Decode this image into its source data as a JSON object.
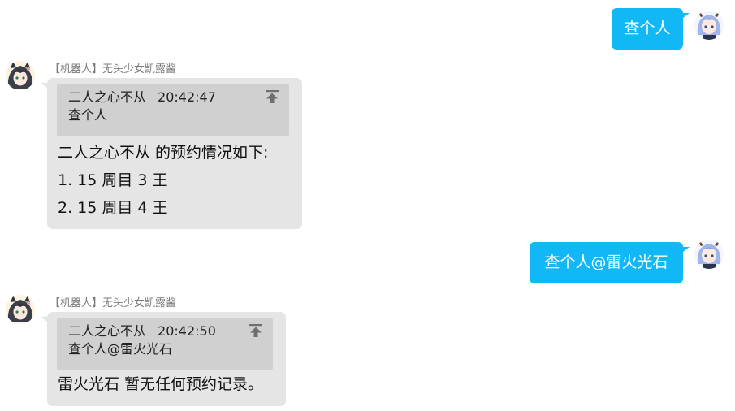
{
  "messages": [
    {
      "direction": "out",
      "text": "查个人"
    },
    {
      "direction": "in",
      "sender": "【机器人】无头少女凯露酱",
      "quote": {
        "name": "二人之心不从",
        "time": "20:42:47",
        "text": "查个人"
      },
      "lines": [
        "二人之心不从 的预约情况如下:",
        "1. 15 周目 3 王",
        "2. 15 周目 4 王"
      ]
    },
    {
      "direction": "out",
      "text": "查个人@雷火光石"
    },
    {
      "direction": "in",
      "sender": "【机器人】无头少女凯露酱",
      "quote": {
        "name": "二人之心不从",
        "time": "20:42:50",
        "text": "查个人@雷火光石"
      },
      "lines": [
        "雷火光石 暂无任何预约记录。"
      ]
    }
  ],
  "icons": {
    "user_avatar": "user-avatar",
    "bot_avatar": "bot-avatar",
    "jump_to_original": "arrow-up-to-line-icon"
  },
  "colors": {
    "outgoing_bubble": "#12b7f5",
    "incoming_bubble": "#e5e5e5",
    "quote_block": "#d0d0d0",
    "sender_name": "#7a7a7a"
  }
}
